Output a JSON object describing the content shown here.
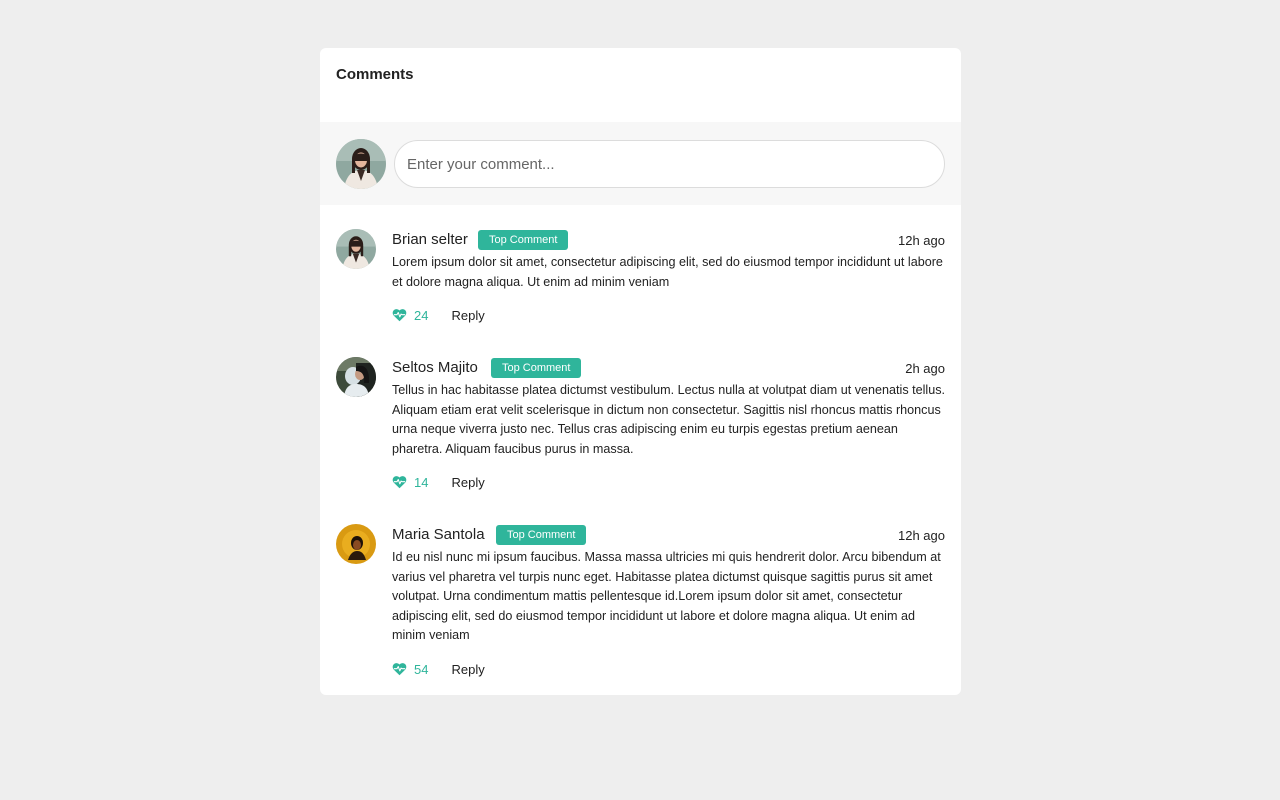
{
  "header": {
    "title": "Comments"
  },
  "composer": {
    "placeholder": "Enter your comment..."
  },
  "colors": {
    "accent": "#2fb59b",
    "background": "#eeeeee",
    "card": "#ffffff",
    "composer_bg": "#f7f7f7"
  },
  "comments": [
    {
      "name": "Brian selter",
      "badge": "Top Comment",
      "time": "12h ago",
      "text": "Lorem ipsum dolor sit amet, consectetur adipiscing elit, sed do eiusmod tempor incididunt ut labore et dolore magna aliqua. Ut enim ad minim veniam",
      "likes": "24",
      "reply_label": "Reply"
    },
    {
      "name": "Seltos Majito",
      "badge": "Top Comment",
      "time": "2h ago",
      "text": "Tellus in hac habitasse platea dictumst vestibulum. Lectus nulla at volutpat diam ut venenatis tellus. Aliquam etiam erat velit scelerisque in dictum non consectetur. Sagittis nisl rhoncus mattis rhoncus urna neque viverra justo nec. Tellus cras adipiscing enim eu turpis egestas pretium aenean pharetra. Aliquam faucibus purus in massa.",
      "likes": "14",
      "reply_label": "Reply"
    },
    {
      "name": "Maria Santola",
      "badge": "Top Comment",
      "time": "12h ago",
      "text": "Id eu nisl nunc mi ipsum faucibus. Massa massa ultricies mi quis hendrerit dolor. Arcu bibendum at varius vel pharetra vel turpis nunc eget. Habitasse platea dictumst quisque sagittis purus sit amet volutpat. Urna condimentum mattis pellentesque id.Lorem ipsum dolor sit amet, consectetur adipiscing elit, sed do eiusmod tempor incididunt ut labore et dolore magna aliqua. Ut enim ad minim veniam",
      "likes": "54",
      "reply_label": "Reply"
    }
  ]
}
